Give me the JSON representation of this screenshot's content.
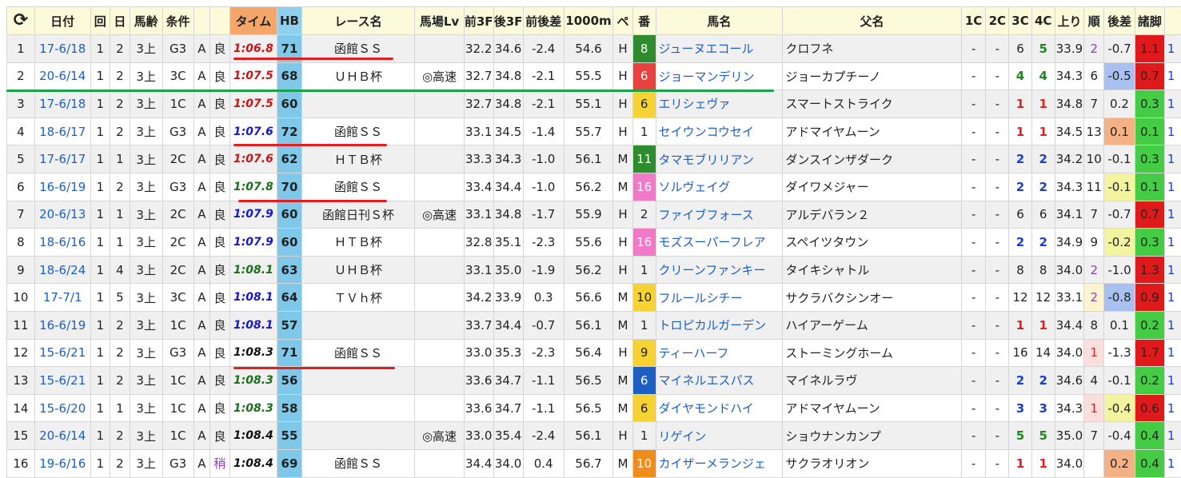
{
  "columns": [
    "⟳",
    "日付",
    "回",
    "日",
    "馬齢",
    "条件",
    "",
    "",
    "タイム",
    "HB",
    "レース名",
    "馬場Lv",
    "前3F",
    "後3F",
    "前後差",
    "1000m",
    "ペ",
    "番",
    "馬名",
    "父名",
    "1C",
    "2C",
    "3C",
    "4C",
    "上り",
    "順",
    "後差",
    "諸脚",
    ""
  ],
  "colors": {
    "time_red": "#c81414",
    "time_blue": "#1818c8",
    "time_green": "#1b6e1b",
    "corner_red": "#e02020",
    "corner_blue": "#1a3fd0",
    "corner_green": "#1b8a1b",
    "zan_red": "#e01a1a",
    "zan_green": "#44cc44",
    "zan_yellow": "#f3f3a0",
    "underline_red": "#e02020",
    "underline_green": "#1aa34a"
  },
  "rows": [
    {
      "no": "1",
      "date": "17-6/18",
      "kai": "1",
      "nichi": "2",
      "age": "3上",
      "cond": "G3",
      "a": "A",
      "baba": "良",
      "time": "1:06.8",
      "tc": "red",
      "hb": "71",
      "race": "函館ＳＳ",
      "lv": "",
      "f3": "32.2",
      "l3": "34.6",
      "diff": "-2.4",
      "m1000": "54.6",
      "pace": "H",
      "ban": "8",
      "banc": "#2e8b2e",
      "horse": "ジューヌエコール",
      "sire": "クロフネ",
      "c1": "-",
      "c2": "-",
      "c3": "6",
      "c3c": "",
      "c4": "5",
      "c4c": "green",
      "agari": "33.9",
      "jun": "2",
      "junc": "jun2",
      "sa": "-0.7",
      "sac": "sa-blue",
      "zan": "1.1",
      "zanc": "#e01a1a",
      "extra": "1"
    },
    {
      "no": "2",
      "date": "20-6/14",
      "kai": "1",
      "nichi": "2",
      "age": "3上",
      "cond": "3C",
      "a": "A",
      "baba": "良",
      "time": "1:07.5",
      "tc": "red",
      "hb": "68",
      "race": "ＵＨＢ杯",
      "lv": "◎高速",
      "f3": "32.7",
      "l3": "34.8",
      "diff": "-2.1",
      "m1000": "55.5",
      "pace": "H",
      "ban": "6",
      "banc": "#e8423f",
      "horse": "ジョーマンデリン",
      "sire": "ジョーカプチーノ",
      "c1": "-",
      "c2": "-",
      "c3": "4",
      "c3c": "green",
      "c4": "4",
      "c4c": "green",
      "agari": "34.3",
      "jun": "6",
      "junc": "",
      "sa": "-0.5",
      "sac": "sa-blue",
      "zan": "0.7",
      "zanc": "#e01a1a",
      "extra": "1"
    },
    {
      "no": "3",
      "date": "17-6/18",
      "kai": "1",
      "nichi": "2",
      "age": "3上",
      "cond": "1C",
      "a": "A",
      "baba": "良",
      "time": "1:07.5",
      "tc": "red",
      "hb": "60",
      "race": "",
      "lv": "",
      "f3": "32.7",
      "l3": "34.8",
      "diff": "-2.1",
      "m1000": "55.1",
      "pace": "H",
      "ban": "6",
      "banc": "#f6d232",
      "horse": "エリシェヴァ",
      "sire": "スマートストライク",
      "c1": "-",
      "c2": "-",
      "c3": "1",
      "c3c": "red",
      "c4": "1",
      "c4c": "red",
      "agari": "34.8",
      "jun": "7",
      "junc": "",
      "sa": "0.2",
      "sac": "sa-orange",
      "zan": "0.3",
      "zanc": "#44cc44",
      "extra": "1"
    },
    {
      "no": "4",
      "date": "18-6/17",
      "kai": "1",
      "nichi": "2",
      "age": "3上",
      "cond": "G3",
      "a": "A",
      "baba": "良",
      "time": "1:07.6",
      "tc": "blue",
      "hb": "72",
      "race": "函館ＳＳ",
      "lv": "",
      "f3": "33.1",
      "l3": "34.5",
      "diff": "-1.4",
      "m1000": "55.7",
      "pace": "H",
      "ban": "1",
      "banc": "",
      "horse": "セイウンコウセイ",
      "sire": "アドマイヤムーン",
      "c1": "-",
      "c2": "-",
      "c3": "1",
      "c3c": "red",
      "c4": "1",
      "c4c": "red",
      "agari": "34.5",
      "jun": "13",
      "junc": "",
      "sa": "0.1",
      "sac": "sa-orange",
      "zan": "0.1",
      "zanc": "#44cc44",
      "extra": "1"
    },
    {
      "no": "5",
      "date": "17-6/17",
      "kai": "1",
      "nichi": "1",
      "age": "3上",
      "cond": "2C",
      "a": "A",
      "baba": "良",
      "time": "1:07.6",
      "tc": "red",
      "hb": "62",
      "race": "ＨＴＢ杯",
      "lv": "",
      "f3": "33.3",
      "l3": "34.3",
      "diff": "-1.0",
      "m1000": "56.1",
      "pace": "M",
      "ban": "11",
      "banc": "#2e8b2e",
      "horse": "タマモブリリアン",
      "sire": "ダンスインザダーク",
      "c1": "-",
      "c2": "-",
      "c3": "2",
      "c3c": "blue",
      "c4": "2",
      "c4c": "blue",
      "agari": "34.2",
      "jun": "10",
      "junc": "",
      "sa": "-0.1",
      "sac": "sa-yellow",
      "zan": "0.3",
      "zanc": "#44cc44",
      "extra": "1"
    },
    {
      "no": "6",
      "date": "16-6/19",
      "kai": "1",
      "nichi": "2",
      "age": "3上",
      "cond": "G3",
      "a": "A",
      "baba": "良",
      "time": "1:07.8",
      "tc": "green",
      "hb": "70",
      "race": "函館ＳＳ",
      "lv": "",
      "f3": "33.4",
      "l3": "34.4",
      "diff": "-1.0",
      "m1000": "56.2",
      "pace": "M",
      "ban": "16",
      "banc": "#f07ac8",
      "horse": "ソルヴェイグ",
      "sire": "ダイワメジャー",
      "c1": "-",
      "c2": "-",
      "c3": "2",
      "c3c": "blue",
      "c4": "2",
      "c4c": "blue",
      "agari": "34.3",
      "jun": "11",
      "junc": "",
      "sa": "-0.1",
      "sac": "sa-yellow",
      "zan": "0.1",
      "zanc": "#44cc44",
      "extra": "1"
    },
    {
      "no": "7",
      "date": "20-6/13",
      "kai": "1",
      "nichi": "1",
      "age": "3上",
      "cond": "2C",
      "a": "A",
      "baba": "良",
      "time": "1:07.9",
      "tc": "blue",
      "hb": "60",
      "race": "函館日刊Ｓ杯",
      "lv": "◎高速",
      "f3": "33.1",
      "l3": "34.8",
      "diff": "-1.7",
      "m1000": "55.9",
      "pace": "H",
      "ban": "2",
      "banc": "",
      "horse": "ファイブフォース",
      "sire": "アルデバラン２",
      "c1": "-",
      "c2": "-",
      "c3": "6",
      "c3c": "",
      "c4": "6",
      "c4c": "",
      "agari": "34.1",
      "jun": "7",
      "junc": "",
      "sa": "-0.7",
      "sac": "sa-blue",
      "zan": "0.7",
      "zanc": "#e01a1a",
      "extra": "1"
    },
    {
      "no": "8",
      "date": "18-6/16",
      "kai": "1",
      "nichi": "1",
      "age": "3上",
      "cond": "2C",
      "a": "A",
      "baba": "良",
      "time": "1:07.9",
      "tc": "blue",
      "hb": "60",
      "race": "ＨＴＢ杯",
      "lv": "",
      "f3": "32.8",
      "l3": "35.1",
      "diff": "-2.3",
      "m1000": "55.6",
      "pace": "H",
      "ban": "16",
      "banc": "#f07ac8",
      "horse": "モズスーパーフレア",
      "sire": "スペイツタウン",
      "c1": "-",
      "c2": "-",
      "c3": "2",
      "c3c": "blue",
      "c4": "2",
      "c4c": "blue",
      "agari": "34.9",
      "jun": "9",
      "junc": "",
      "sa": "-0.2",
      "sac": "sa-yellow",
      "zan": "0.3",
      "zanc": "#44cc44",
      "extra": "1"
    },
    {
      "no": "9",
      "date": "18-6/24",
      "kai": "1",
      "nichi": "4",
      "age": "3上",
      "cond": "2C",
      "a": "A",
      "baba": "良",
      "time": "1:08.1",
      "tc": "green",
      "hb": "63",
      "race": "ＵＨＢ杯",
      "lv": "",
      "f3": "33.1",
      "l3": "35.0",
      "diff": "-1.9",
      "m1000": "56.2",
      "pace": "H",
      "ban": "1",
      "banc": "",
      "horse": "クリーンファンキー",
      "sire": "タイキシャトル",
      "c1": "-",
      "c2": "-",
      "c3": "8",
      "c3c": "",
      "c4": "8",
      "c4c": "",
      "agari": "34.0",
      "jun": "2",
      "junc": "jun2",
      "sa": "-1.0",
      "sac": "sa-yellow",
      "zan": "1.3",
      "zanc": "#e01a1a",
      "extra": "1"
    },
    {
      "no": "10",
      "date": "17-7/1",
      "kai": "1",
      "nichi": "5",
      "age": "3上",
      "cond": "3C",
      "a": "A",
      "baba": "良",
      "time": "1:08.1",
      "tc": "blue",
      "hb": "64",
      "race": "ＴＶｈ杯",
      "lv": "",
      "f3": "34.2",
      "l3": "33.9",
      "diff": "0.3",
      "m1000": "56.6",
      "pace": "M",
      "ban": "10",
      "banc": "#f6d232",
      "horse": "フルールシチー",
      "sire": "サクラバクシンオー",
      "c1": "-",
      "c2": "-",
      "c3": "12",
      "c3c": "",
      "c4": "12",
      "c4c": "",
      "agari": "33.1",
      "jun": "2",
      "junc": "jun2",
      "sa": "-0.8",
      "sac": "sa-blue",
      "zan": "0.9",
      "zanc": "#e01a1a",
      "extra": "1"
    },
    {
      "no": "11",
      "date": "16-6/19",
      "kai": "1",
      "nichi": "2",
      "age": "3上",
      "cond": "1C",
      "a": "A",
      "baba": "良",
      "time": "1:08.1",
      "tc": "blue",
      "hb": "57",
      "race": "",
      "lv": "",
      "f3": "33.7",
      "l3": "34.4",
      "diff": "-0.7",
      "m1000": "56.1",
      "pace": "M",
      "ban": "1",
      "banc": "",
      "horse": "トロピカルガーデン",
      "sire": "ハイアーゲーム",
      "c1": "-",
      "c2": "-",
      "c3": "1",
      "c3c": "red",
      "c4": "1",
      "c4c": "red",
      "agari": "34.4",
      "jun": "8",
      "junc": "",
      "sa": "0.1",
      "sac": "sa-orange",
      "zan": "0.2",
      "zanc": "#44cc44",
      "extra": "1"
    },
    {
      "no": "12",
      "date": "15-6/21",
      "kai": "1",
      "nichi": "2",
      "age": "3上",
      "cond": "G3",
      "a": "A",
      "baba": "良",
      "time": "1:08.3",
      "tc": "black",
      "hb": "71",
      "race": "函館ＳＳ",
      "lv": "",
      "f3": "33.0",
      "l3": "35.3",
      "diff": "-2.3",
      "m1000": "56.4",
      "pace": "H",
      "ban": "9",
      "banc": "#f6d232",
      "horse": "ティーハーフ",
      "sire": "ストーミングホーム",
      "c1": "-",
      "c2": "-",
      "c3": "16",
      "c3c": "",
      "c4": "14",
      "c4c": "",
      "agari": "34.0",
      "jun": "1",
      "junc": "jun1",
      "sa": "-1.3",
      "sac": "",
      "zan": "1.7",
      "zanc": "#e01a1a",
      "extra": "1"
    },
    {
      "no": "13",
      "date": "15-6/21",
      "kai": "1",
      "nichi": "2",
      "age": "3上",
      "cond": "1C",
      "a": "A",
      "baba": "良",
      "time": "1:08.3",
      "tc": "green",
      "hb": "56",
      "race": "",
      "lv": "",
      "f3": "33.6",
      "l3": "34.7",
      "diff": "-1.1",
      "m1000": "56.5",
      "pace": "M",
      "ban": "6",
      "banc": "#1b5fc2",
      "horse": "マイネルエスパス",
      "sire": "マイネルラヴ",
      "c1": "-",
      "c2": "-",
      "c3": "2",
      "c3c": "blue",
      "c4": "2",
      "c4c": "blue",
      "agari": "34.6",
      "jun": "4",
      "junc": "",
      "sa": "-0.1",
      "sac": "sa-yellow",
      "zan": "0.2",
      "zanc": "#44cc44",
      "extra": "1"
    },
    {
      "no": "14",
      "date": "15-6/20",
      "kai": "1",
      "nichi": "1",
      "age": "3上",
      "cond": "1C",
      "a": "A",
      "baba": "良",
      "time": "1:08.3",
      "tc": "green",
      "hb": "58",
      "race": "",
      "lv": "",
      "f3": "33.6",
      "l3": "34.7",
      "diff": "-1.1",
      "m1000": "56.5",
      "pace": "M",
      "ban": "6",
      "banc": "#f6d232",
      "horse": "ダイヤモンドハイ",
      "sire": "アドマイヤムーン",
      "c1": "-",
      "c2": "-",
      "c3": "3",
      "c3c": "blue",
      "c4": "3",
      "c4c": "blue",
      "agari": "34.3",
      "jun": "1",
      "junc": "jun1",
      "sa": "-0.4",
      "sac": "sa-yellow",
      "zan": "0.6",
      "zanc": "#e01a1a",
      "extra": "1"
    },
    {
      "no": "15",
      "date": "20-6/14",
      "kai": "1",
      "nichi": "2",
      "age": "3上",
      "cond": "1C",
      "a": "A",
      "baba": "良",
      "time": "1:08.4",
      "tc": "black",
      "hb": "55",
      "race": "",
      "lv": "◎高速",
      "f3": "33.0",
      "l3": "35.4",
      "diff": "-2.4",
      "m1000": "56.1",
      "pace": "H",
      "ban": "1",
      "banc": "",
      "horse": "リゲイン",
      "sire": "ショウナンカンプ",
      "c1": "-",
      "c2": "-",
      "c3": "5",
      "c3c": "green",
      "c4": "5",
      "c4c": "green",
      "agari": "35.0",
      "jun": "7",
      "junc": "",
      "sa": "-0.4",
      "sac": "sa-yellow",
      "zan": "0.4",
      "zanc": "#44cc44",
      "extra": "1"
    },
    {
      "no": "16",
      "date": "19-6/16",
      "kai": "1",
      "nichi": "2",
      "age": "3上",
      "cond": "G3",
      "a": "A",
      "baba": "稍",
      "time": "1:08.4",
      "tc": "black",
      "hb": "69",
      "race": "函館ＳＳ",
      "lv": "",
      "f3": "34.4",
      "l3": "34.0",
      "diff": "0.4",
      "m1000": "56.7",
      "pace": "M",
      "ban": "10",
      "banc": "#f08c1a",
      "horse": "カイザーメランジェ",
      "sire": "サクラオリオン",
      "c1": "-",
      "c2": "-",
      "c3": "1",
      "c3c": "red",
      "c4": "1",
      "c4c": "red",
      "agari": "34.0",
      "jun": "",
      "junc": "",
      "sa": "0.2",
      "sac": "sa-orange",
      "zan": "0.4",
      "zanc": "#44cc44",
      "extra": "1"
    }
  ]
}
